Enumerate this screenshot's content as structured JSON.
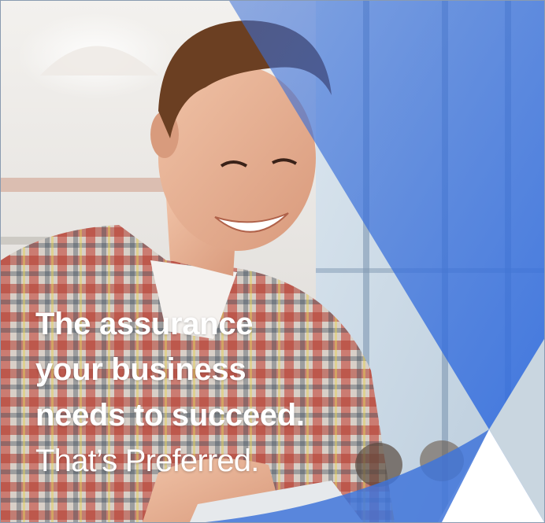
{
  "headline": {
    "line1": "The assurance",
    "line2": "your business",
    "line3": "needs to succeed."
  },
  "tagline": "That’s Preferred.",
  "colors": {
    "brand_blue": "#3f74d9",
    "overlay_blue": "#4a7fd8",
    "light_panel": "#c9d6e0",
    "text": "#ffffff"
  },
  "icons": {
    "decoration": "blue-triangle-overlay"
  }
}
